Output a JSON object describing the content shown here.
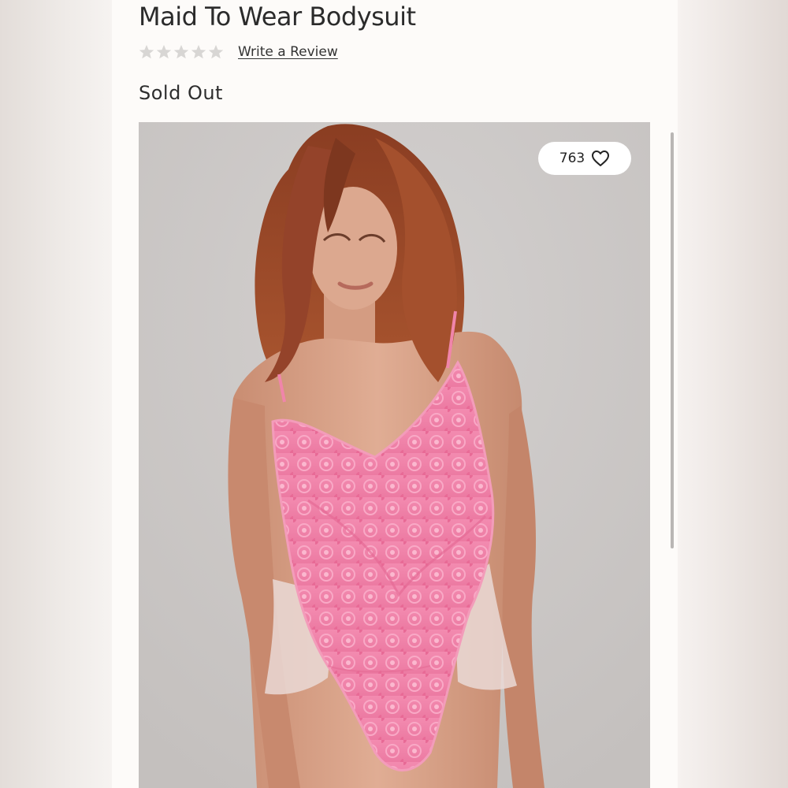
{
  "product": {
    "title": "Maid To Wear Bodysuit",
    "review_link": "Write a Review",
    "rating_stars": 0,
    "status": "Sold Out"
  },
  "image": {
    "like_count": "763",
    "colors": {
      "background": "#cbc8c7",
      "garment": "#f07fa6",
      "hair": "#9c4a2a",
      "skin": "#d9a48a"
    }
  }
}
